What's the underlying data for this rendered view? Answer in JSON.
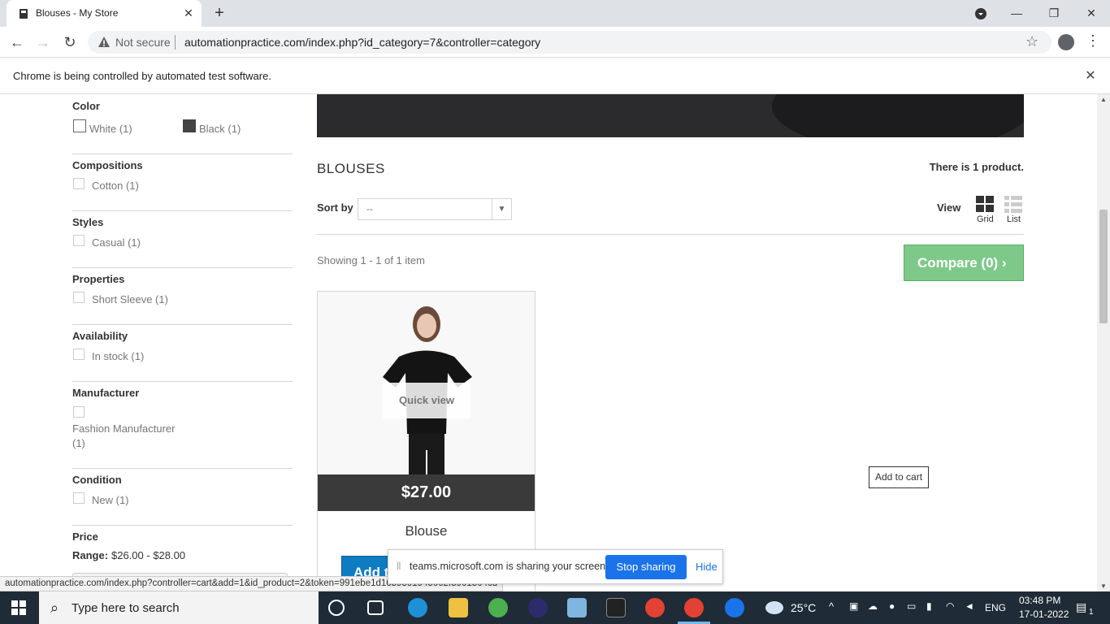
{
  "browser": {
    "tab_title": "Blouses - My Store",
    "tab_close": "✕",
    "new_tab": "+",
    "not_secure": "Not secure",
    "url": "automationpractice.com/index.php?id_category=7&controller=category",
    "infobar_text": "Chrome is being controlled by automated test software.",
    "status_url": "automationpractice.com/index.php?controller=cart&add=1&id_product=2&token=991ebe1d1659591945002f5901504cd"
  },
  "filters": [
    {
      "title": "Color",
      "items": [
        {
          "label": "White (1)",
          "color": "#ffffff"
        },
        {
          "label": "Black (1)",
          "color": "#434348"
        }
      ]
    },
    {
      "title": "Compositions",
      "items": [
        {
          "label": "Cotton (1)"
        }
      ]
    },
    {
      "title": "Styles",
      "items": [
        {
          "label": "Casual (1)"
        }
      ]
    },
    {
      "title": "Properties",
      "items": [
        {
          "label": "Short Sleeve (1)"
        }
      ]
    },
    {
      "title": "Availability",
      "items": [
        {
          "label": "In stock (1)"
        }
      ]
    },
    {
      "title": "Manufacturer",
      "items": [
        {
          "label": "Fashion Manufacturer",
          "label2": "(1)"
        }
      ]
    },
    {
      "title": "Condition",
      "items": [
        {
          "label": "New (1)"
        }
      ]
    },
    {
      "title": "Price",
      "range_label": "Range:",
      "range_value": "$26.00 - $28.00"
    }
  ],
  "category": {
    "title": "BLOUSES",
    "count_prefix": "There is ",
    "count_num": "1",
    "count_suffix": " product.",
    "sort_label": "Sort by",
    "sort_value": "--",
    "view_label": "View",
    "view_grid": "Grid",
    "view_list": "List",
    "showing": "Showing 1 - 1 of 1 item",
    "compare": "Compare (0)"
  },
  "product": {
    "quick_view": "Quick view",
    "price": "$27.00",
    "name": "Blouse",
    "add_partial": "Add t",
    "tooltip": "Add to cart"
  },
  "share_bar": {
    "text": "teams.microsoft.com is sharing your screen.",
    "stop": "Stop sharing",
    "hide": "Hide"
  },
  "taskbar": {
    "search_placeholder": "Type here to search",
    "weather": "25°C",
    "lang": "ENG",
    "time": "03:48 PM",
    "date": "17-01-2022",
    "notifications": "1"
  },
  "colors": {
    "compare_green": "#7ec98a",
    "add_blue": "#0e7cc0",
    "stop_blue": "#1a73e8"
  }
}
